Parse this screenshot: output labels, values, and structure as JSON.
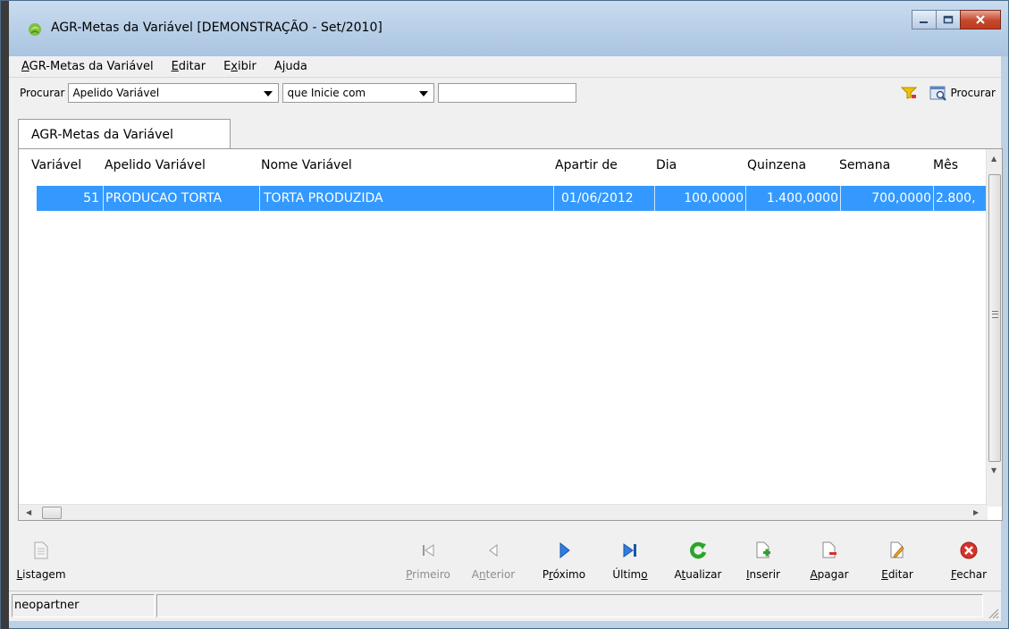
{
  "window": {
    "title": "AGR-Metas da Variável [DEMONSTRAÇÃO - Set/2010]"
  },
  "menu": [
    "AGR-Metas da Variável",
    "Editar",
    "Exibir",
    "Ajuda"
  ],
  "search": {
    "label": "Procurar",
    "field_value": "Apelido Variável",
    "condition_value": "que Inicie com",
    "text_value": "",
    "button_label": "Procurar"
  },
  "tab": {
    "label": "AGR-Metas da Variável"
  },
  "grid": {
    "columns": [
      "Variável",
      "Apelido Variável",
      "Nome Variável",
      "Apartir de",
      "Dia",
      "Quinzena",
      "Semana",
      "Mês"
    ],
    "rows": [
      [
        "51",
        "PRODUCAO TORTA",
        "TORTA PRODUZIDA",
        "01/06/2012",
        "100,0000",
        "1.400,0000",
        "700,0000",
        "2.800,"
      ]
    ]
  },
  "toolbar": {
    "listagem": "Listagem",
    "primeiro": "Primeiro",
    "anterior": "Anterior",
    "proximo": "Próximo",
    "ultimo": "Último",
    "atualizar": "Atualizar",
    "inserir": "Inserir",
    "apagar": "Apagar",
    "editar": "Editar",
    "fechar": "Fechar"
  },
  "status": {
    "user": "neopartner"
  },
  "colors": {
    "selection": "#3399ff",
    "nav_blue": "#1f6fd6",
    "refresh_green": "#2aa52a",
    "close_red": "#d6322a"
  }
}
